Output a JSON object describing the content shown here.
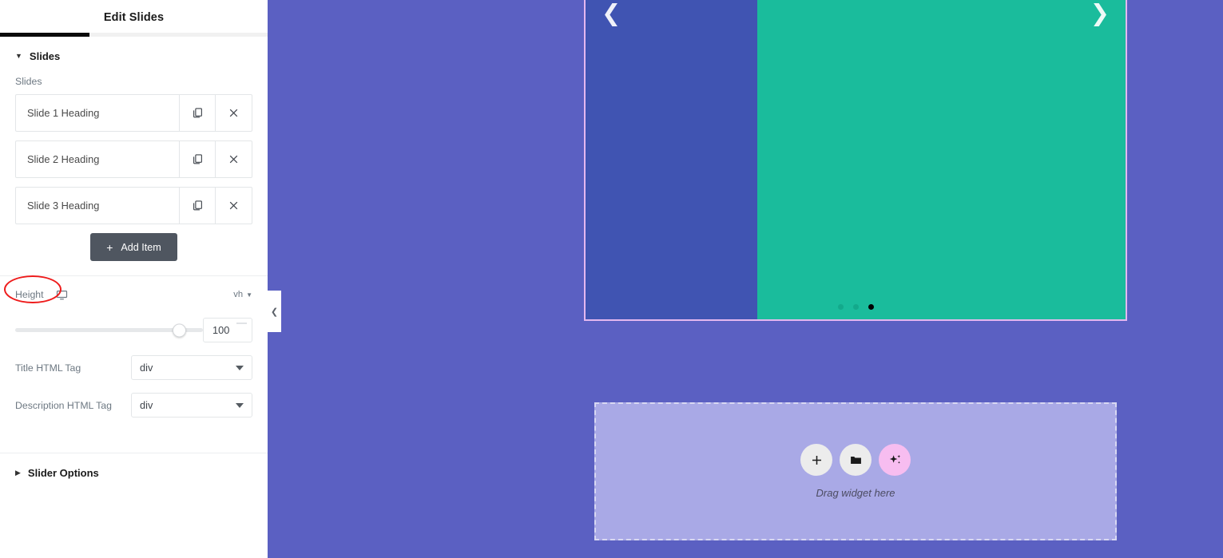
{
  "panel": {
    "title": "Edit Slides",
    "tabs_active_indicator": true,
    "sections": {
      "slides": {
        "caret": "caret-down-icon",
        "title": "Slides",
        "field_label": "Slides",
        "items": [
          {
            "title": "Slide 1 Heading",
            "duplicate_icon": "copy-icon",
            "remove_icon": "close-icon"
          },
          {
            "title": "Slide 2 Heading",
            "duplicate_icon": "copy-icon",
            "remove_icon": "close-icon"
          },
          {
            "title": "Slide 3 Heading",
            "duplicate_icon": "copy-icon",
            "remove_icon": "close-icon"
          }
        ],
        "add_item_label": "Add Item",
        "add_item_plus": "+",
        "height": {
          "label": "Height",
          "device_icon": "desktop-icon",
          "unit": "vh",
          "unit_chevron": "chevron-down-icon",
          "value": "100",
          "slider_percent": 100
        },
        "title_html_tag": {
          "label": "Title HTML Tag",
          "value": "div"
        },
        "description_html_tag": {
          "label": "Description HTML Tag",
          "value": "div"
        }
      },
      "slider_options": {
        "caret": "caret-right-icon",
        "title": "Slider Options"
      }
    },
    "collapse_handle_icon": "chevron-left-icon"
  },
  "canvas": {
    "background_color": "#5b60c2",
    "slider_widget": {
      "border_color": "#e4b8f0",
      "slide_left_color": "#4054b2",
      "slide_right_color": "#1abc9c",
      "prev_arrow": "❮",
      "next_arrow": "❯",
      "dots": [
        {
          "active": false
        },
        {
          "active": false
        },
        {
          "active": true
        }
      ]
    },
    "drop_zone": {
      "label": "Drag widget here",
      "buttons": [
        {
          "icon": "plus-icon",
          "style": "light"
        },
        {
          "icon": "folder-icon",
          "style": "light"
        },
        {
          "icon": "ai-sparkle-icon",
          "style": "ai"
        }
      ]
    }
  },
  "annotation": {
    "height_highlight_color": "#ee1b1b",
    "target": "Height"
  }
}
